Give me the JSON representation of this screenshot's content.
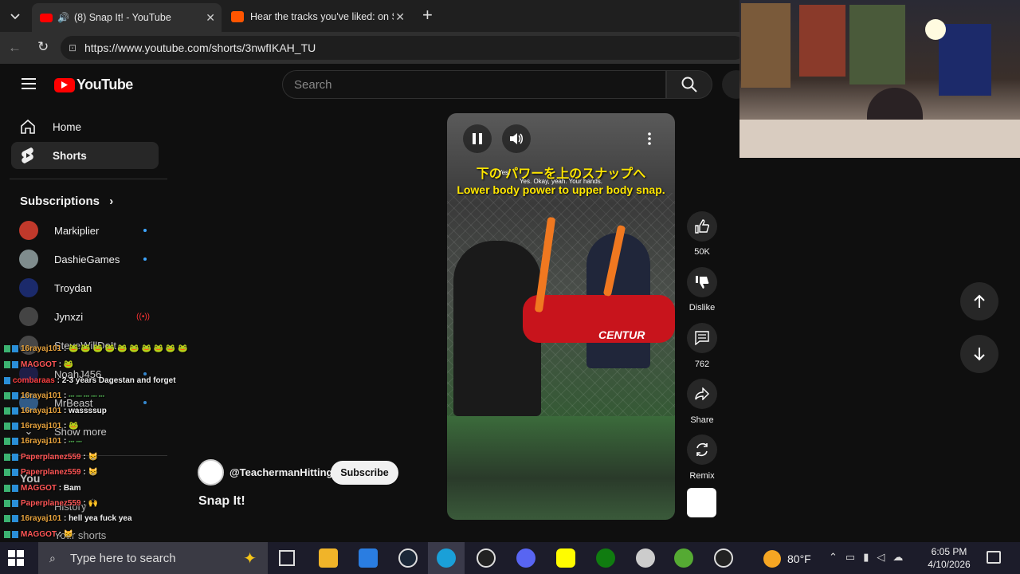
{
  "browser": {
    "tabs": [
      {
        "title": "(8) Snap It! - YouTube",
        "active": true
      },
      {
        "title": "Hear the tracks you've liked: on So",
        "active": false
      }
    ],
    "url": "https://www.youtube.com/shorts/3nwfIKAH_TU",
    "new_tab_label": "+"
  },
  "youtube": {
    "logo_text": "YouTube",
    "search_placeholder": "Search",
    "nav": [
      {
        "label": "Home",
        "icon": "home-icon"
      },
      {
        "label": "Shorts",
        "icon": "shorts-icon"
      }
    ],
    "subscriptions_title": "Subscriptions",
    "subscriptions": [
      {
        "name": "Markiplier",
        "new": true,
        "color": "#c0392b"
      },
      {
        "name": "DashieGames",
        "new": true,
        "color": "#7f8c8d"
      },
      {
        "name": "Troydan",
        "new": false,
        "color": "#1b2a6b"
      },
      {
        "name": "Jynxzi",
        "new": false,
        "live": true,
        "color": "#444"
      },
      {
        "name": "SteveWillDoIt",
        "new": false,
        "color": "#555"
      },
      {
        "name": "NoahJ456",
        "new": true,
        "color": "#225"
      },
      {
        "name": "MrBeast",
        "new": true,
        "color": "#3a6ea5"
      }
    ],
    "show_more": "Show more",
    "you_section": "You",
    "you_items": [
      "History",
      "Your shorts"
    ],
    "short": {
      "channel": "@TeachermanHitting",
      "subscribe_label": "Subscribe",
      "title": "Snap It!",
      "caption_jp": "下の パワーを上のスナップへ",
      "caption_en": "Lower body power to upper body snap.",
      "caption_small1": "Yes.",
      "caption_small2": "Yes. Okay, yeah. Your hands.",
      "banner_text": "CENTUR",
      "likes": "50K",
      "dislike_label": "Dislike",
      "comments": "762",
      "share_label": "Share",
      "remix_label": "Remix"
    }
  },
  "chat": [
    {
      "user": "16rayaj101",
      "msg": "",
      "color": "#e8a33c"
    },
    {
      "user": "MAGGOT",
      "msg": "",
      "color": "#ff5555"
    },
    {
      "user": "combaraas",
      "msg": "2-3 years Dagestan and forget",
      "color": "#ff4040"
    },
    {
      "user": "16rayaj101",
      "msg": "",
      "color": "#e8a33c"
    },
    {
      "user": "16rayaj101",
      "msg": "wassssup",
      "color": "#e8a33c"
    },
    {
      "user": "16rayaj101",
      "msg": "",
      "color": "#e8a33c"
    },
    {
      "user": "16rayaj101",
      "msg": "",
      "color": "#e8a33c"
    },
    {
      "user": "Paperplanez559",
      "msg": "",
      "color": "#ff5555"
    },
    {
      "user": "Paperplanez559",
      "msg": "",
      "color": "#ff5555"
    },
    {
      "user": "MAGGOT",
      "msg": "Bam",
      "color": "#ff5555"
    },
    {
      "user": "Paperplanez559",
      "msg": "",
      "color": "#ff5555"
    },
    {
      "user": "16rayaj101",
      "msg": "hell yea fuck yea",
      "color": "#e8a33c"
    },
    {
      "user": "MAGGOT",
      "msg": "",
      "color": "#ff5555"
    },
    {
      "user": "Paperplanez559",
      "msg": "",
      "color": "#ff5555"
    },
    {
      "user": "MAGGOT",
      "msg": "",
      "color": "#ff5555"
    }
  ],
  "taskbar": {
    "search_placeholder": "Type here to search",
    "weather": "80°F",
    "time": "6:05 PM",
    "date": "4/10/2026"
  }
}
